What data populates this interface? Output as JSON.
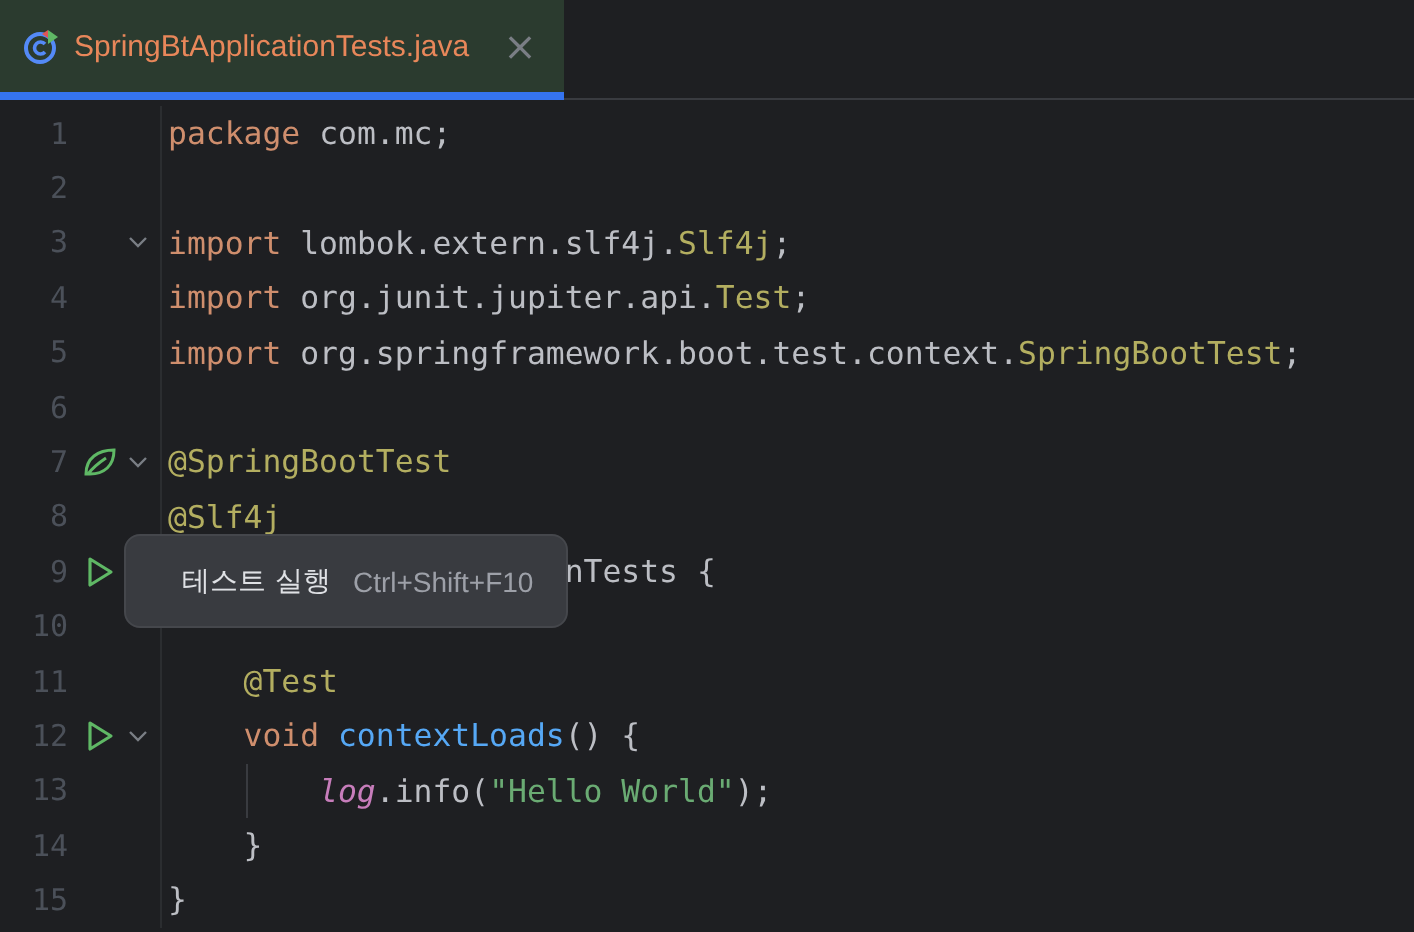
{
  "tab": {
    "title": "SpringBtApplicationTests.java",
    "close": "×",
    "selected": true
  },
  "lines": [
    {
      "number": "1",
      "tokens": [
        {
          "kind": "keyword",
          "text": "package"
        },
        {
          "kind": "plain",
          "text": " com.mc;"
        }
      ]
    },
    {
      "number": "2"
    },
    {
      "number": "3",
      "fold": true,
      "tokens": [
        {
          "kind": "keyword",
          "text": "import"
        },
        {
          "kind": "plain",
          "text": " lombok.extern.slf4j."
        },
        {
          "kind": "annotation",
          "text": "Slf4j"
        },
        {
          "kind": "plain",
          "text": ";"
        }
      ]
    },
    {
      "number": "4",
      "tokens": [
        {
          "kind": "keyword",
          "text": "import"
        },
        {
          "kind": "plain",
          "text": " org.junit.jupiter.api."
        },
        {
          "kind": "annotation",
          "text": "Test"
        },
        {
          "kind": "plain",
          "text": ";"
        }
      ]
    },
    {
      "number": "5",
      "tokens": [
        {
          "kind": "keyword",
          "text": "import"
        },
        {
          "kind": "plain",
          "text": " org.springframework.boot.test.context."
        },
        {
          "kind": "annotation",
          "text": "SpringBootTest"
        },
        {
          "kind": "plain",
          "text": ";"
        }
      ]
    },
    {
      "number": "6"
    },
    {
      "number": "7",
      "spring": true,
      "fold": true,
      "tokens": [
        {
          "kind": "annotation",
          "text": "@SpringBootTest"
        }
      ]
    },
    {
      "number": "8",
      "tokens": [
        {
          "kind": "annotation",
          "text": "@Slf4j"
        }
      ]
    },
    {
      "number": "9",
      "runnable": true,
      "covered": true,
      "tokens": [
        {
          "kind": "plain",
          "text": "nTests {"
        }
      ],
      "children": [
        {
          "number": "10"
        },
        {
          "number": "11",
          "tokens": [
            {
              "kind": "annotation",
              "text": "@Test"
            }
          ]
        },
        {
          "number": "12",
          "runnable": true,
          "fold": true,
          "tokens": [
            {
              "kind": "keyword",
              "text": "void"
            },
            {
              "kind": "method",
              "text": " contextLoads"
            },
            {
              "kind": "plain",
              "text": "() {"
            }
          ],
          "children": [
            {
              "number": "13",
              "guide": true,
              "tokens": [
                {
                  "kind": "field",
                  "text": "log"
                },
                {
                  "kind": "plain",
                  "text": ".info("
                },
                {
                  "kind": "string",
                  "text": "\"Hello World\""
                },
                {
                  "kind": "plain",
                  "text": ");"
                }
              ]
            }
          ]
        },
        {
          "number": "14",
          "tokens": [
            {
              "kind": "plain",
              "text": "}"
            }
          ]
        }
      ]
    },
    {
      "number": "15",
      "tokens": [
        {
          "kind": "plain",
          "text": "}"
        }
      ]
    }
  ],
  "tooltip": {
    "label": "테스트 실행",
    "shortcut": "Ctrl+Shift+F10"
  }
}
